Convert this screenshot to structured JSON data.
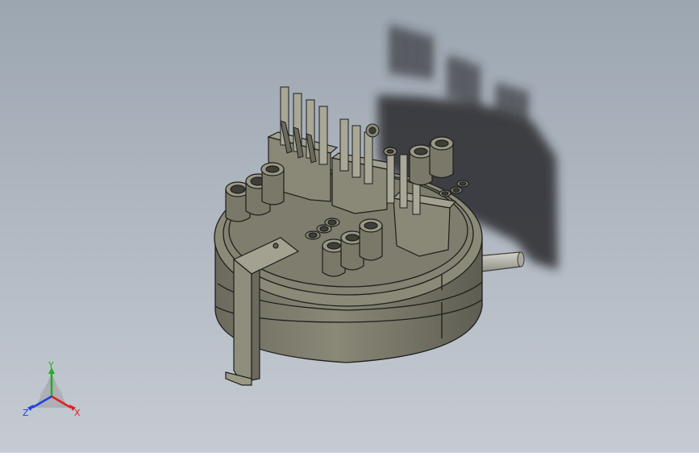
{
  "scene": {
    "background_top": "#9ca6b0",
    "background_bottom": "#c6cbd3",
    "part_color": "#7f7d6e",
    "part_dark": "#55544a",
    "part_light": "#a3a18f",
    "edge_color": "#1e1e1c",
    "shadow_color": "#2a2c2e",
    "shaft_color": "#b9b8ae"
  },
  "triad": {
    "x_label": "X",
    "y_label": "Y",
    "z_label": "Z",
    "x_color": "#e02020",
    "y_color": "#20b020",
    "z_color": "#2040e0"
  }
}
